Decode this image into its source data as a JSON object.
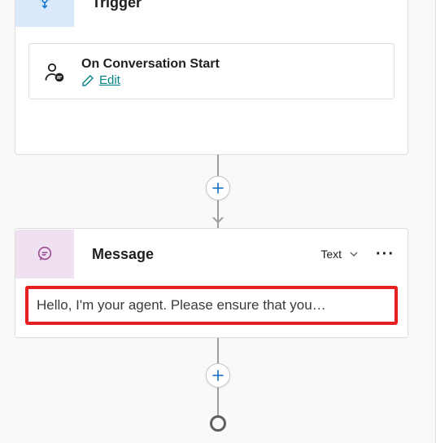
{
  "trigger": {
    "header_title": "Trigger",
    "event_title": "On Conversation Start",
    "edit_label": "Edit"
  },
  "message": {
    "header_title": "Message",
    "type_label": "Text",
    "content": "Hello, I'm your agent. Please ensure that you…"
  }
}
